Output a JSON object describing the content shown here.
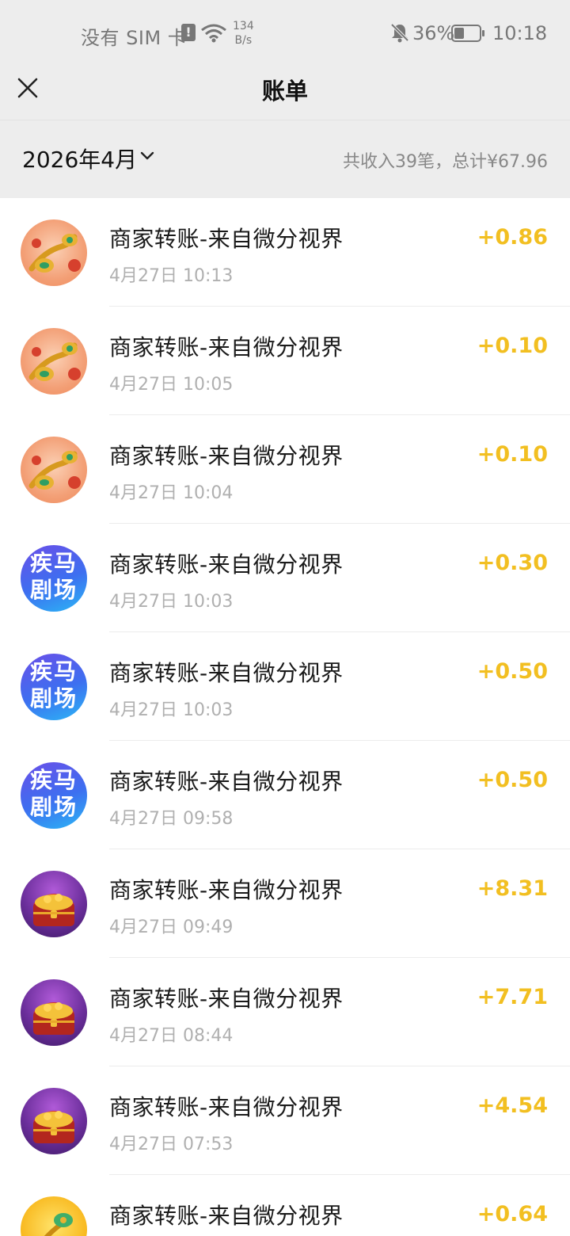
{
  "status_bar": {
    "sim_text": "没有 SIM 卡",
    "alert_glyph": "!",
    "speed_value": "134",
    "speed_unit": "B/s",
    "battery_pct": "36%",
    "time": "10:18",
    "battery_level": 0.36,
    "icons": [
      "sim-alert-icon",
      "wifi-icon",
      "bell-muted-icon",
      "battery-icon"
    ]
  },
  "header": {
    "title": "账单",
    "close_icon": "close-icon"
  },
  "summary": {
    "month": "2026年4月",
    "total_text": "共收入39笔，总计¥67.96"
  },
  "colors": {
    "amount": "#f2bf21",
    "background_gray": "#ededed",
    "time_gray": "#b0b0b0"
  },
  "transactions": [
    {
      "avatar": "ruyi",
      "name": "商家转账-来自微分视界",
      "time": "4月27日 10:13",
      "amount": "+0.86"
    },
    {
      "avatar": "ruyi",
      "name": "商家转账-来自微分视界",
      "time": "4月27日 10:05",
      "amount": "+0.10"
    },
    {
      "avatar": "ruyi",
      "name": "商家转账-来自微分视界",
      "time": "4月27日 10:04",
      "amount": "+0.10"
    },
    {
      "avatar": "drama",
      "avatar_text_1": "疾马",
      "avatar_text_2": "剧场",
      "name": "商家转账-来自微分视界",
      "time": "4月27日 10:03",
      "amount": "+0.30"
    },
    {
      "avatar": "drama",
      "avatar_text_1": "疾马",
      "avatar_text_2": "剧场",
      "name": "商家转账-来自微分视界",
      "time": "4月27日 10:03",
      "amount": "+0.50"
    },
    {
      "avatar": "drama",
      "avatar_text_1": "疾马",
      "avatar_text_2": "剧场",
      "name": "商家转账-来自微分视界",
      "time": "4月27日 09:58",
      "amount": "+0.50"
    },
    {
      "avatar": "chest",
      "name": "商家转账-来自微分视界",
      "time": "4月27日 09:49",
      "amount": "+8.31"
    },
    {
      "avatar": "chest",
      "name": "商家转账-来自微分视界",
      "time": "4月27日 08:44",
      "amount": "+7.71"
    },
    {
      "avatar": "chest",
      "name": "商家转账-来自微分视界",
      "time": "4月27日 07:53",
      "amount": "+4.54"
    },
    {
      "avatar": "yellow",
      "name": "商家转账-来自微分视界",
      "time": "",
      "amount": "+0.64"
    }
  ]
}
